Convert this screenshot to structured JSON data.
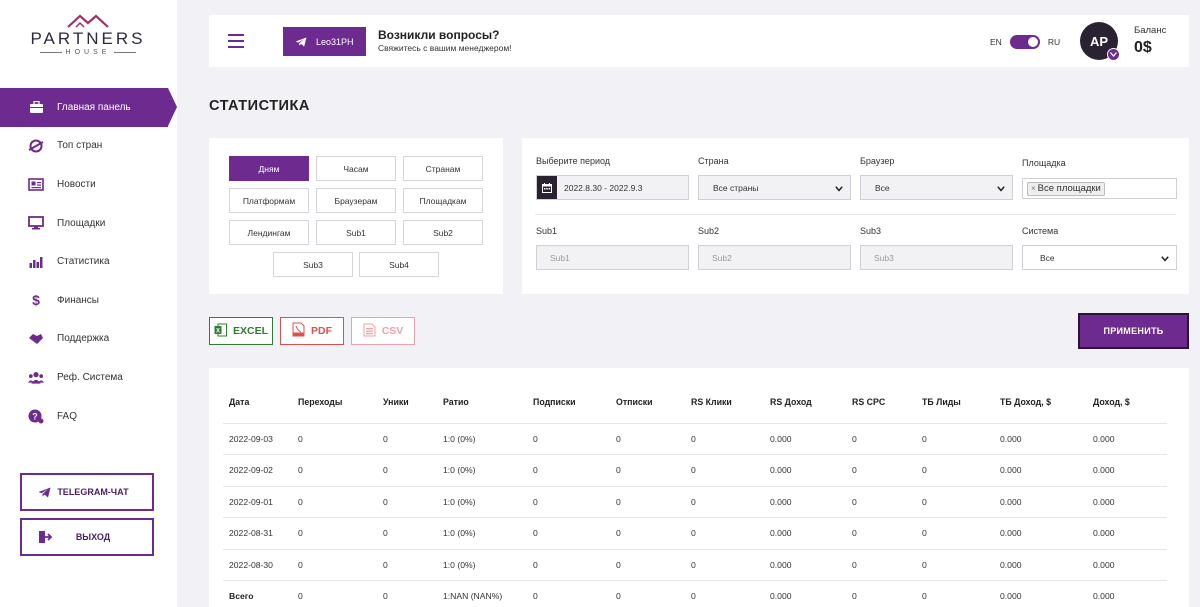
{
  "logo": {
    "brand": "PARTNERS",
    "sub": "HOUSE"
  },
  "sidebar": {
    "items": [
      {
        "label": "Главная панель",
        "icon": "briefcase-icon",
        "active": true
      },
      {
        "label": "Топ стран",
        "icon": "globe-icon"
      },
      {
        "label": "Новости",
        "icon": "newspaper-icon"
      },
      {
        "label": "Площадки",
        "icon": "monitor-icon"
      },
      {
        "label": "Статистика",
        "icon": "bar-chart-icon"
      },
      {
        "label": "Финансы",
        "icon": "dollar-icon"
      },
      {
        "label": "Поддержка",
        "icon": "handshake-icon"
      },
      {
        "label": "Реф. Система",
        "icon": "users-icon"
      },
      {
        "label": "FAQ",
        "icon": "question-icon"
      }
    ],
    "telegram_label": "TELEGRAM-ЧАТ",
    "logout_label": "ВЫХОД"
  },
  "header": {
    "manager_button": "Leo31PH",
    "question_title": "Возникли вопросы?",
    "question_sub": "Свяжитесь с вашим менеджером!",
    "lang_left": "EN",
    "lang_right": "RU",
    "avatar_initials": "AP",
    "balance_label": "Баланс",
    "balance_value": "0$"
  },
  "page_title": "СТАТИСТИКА",
  "group_by": {
    "buttons": [
      "Дням",
      "Часам",
      "Странам",
      "Платформам",
      "Браузерам",
      "Площадкам",
      "Лендингам",
      "Sub1",
      "Sub2",
      "Sub3",
      "Sub4"
    ],
    "active": "Дням"
  },
  "filters": {
    "period_label": "Выберите период",
    "period_value": "2022.8.30 - 2022.9.3",
    "country_label": "Страна",
    "country_value": "Все страны",
    "browser_label": "Браузер",
    "browser_value": "Все",
    "site_label": "Площадка",
    "site_tag": "Все площадки",
    "sub1_label": "Sub1",
    "sub1_placeholder": "Sub1",
    "sub2_label": "Sub2",
    "sub2_placeholder": "Sub2",
    "sub3_label": "Sub3",
    "sub3_placeholder": "Sub3",
    "system_label": "Система",
    "system_value": "Все"
  },
  "export": {
    "excel": "EXCEL",
    "pdf": "PDF",
    "csv": "CSV"
  },
  "apply_label": "ПРИМЕНИТЬ",
  "table": {
    "columns": [
      "Дата",
      "Переходы",
      "Уники",
      "Ратио",
      "Подписки",
      "Отписки",
      "RS Клики",
      "RS Доход",
      "RS CPC",
      "ТБ Лиды",
      "ТБ Доход, $",
      "Доход, $"
    ],
    "rows": [
      [
        "2022-09-03",
        "0",
        "0",
        "1:0 (0%)",
        "0",
        "0",
        "0",
        "0.000",
        "0",
        "0",
        "0.000",
        "0.000"
      ],
      [
        "2022-09-02",
        "0",
        "0",
        "1:0 (0%)",
        "0",
        "0",
        "0",
        "0.000",
        "0",
        "0",
        "0.000",
        "0.000"
      ],
      [
        "2022-09-01",
        "0",
        "0",
        "1:0 (0%)",
        "0",
        "0",
        "0",
        "0.000",
        "0",
        "0",
        "0.000",
        "0.000"
      ],
      [
        "2022-08-31",
        "0",
        "0",
        "1:0 (0%)",
        "0",
        "0",
        "0",
        "0.000",
        "0",
        "0",
        "0.000",
        "0.000"
      ],
      [
        "2022-08-30",
        "0",
        "0",
        "1:0 (0%)",
        "0",
        "0",
        "0",
        "0.000",
        "0",
        "0",
        "0.000",
        "0.000"
      ],
      [
        "Всего",
        "0",
        "0",
        "1:NAN (NAN%)",
        "0",
        "0",
        "0",
        "0.000",
        "0",
        "0",
        "0.000",
        "0.000"
      ]
    ]
  },
  "colors": {
    "accent": "#6d2a8f",
    "dark": "#2a2233",
    "excel": "#2e7d32",
    "pdf": "#d9534f",
    "csv": "#f0a0aa"
  }
}
